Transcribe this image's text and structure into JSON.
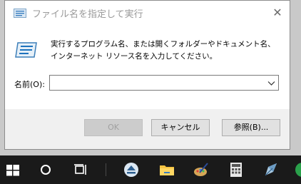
{
  "window": {
    "title": "ファイル名を指定して実行",
    "close_label": "✕"
  },
  "dialog": {
    "description": "実行するプログラム名、または開くフォルダーやドキュメント名、インターネット リソース名を入力してください。",
    "name_label": "名前(O):",
    "name_value": "",
    "ok_label": "OK",
    "cancel_label": "キャンセル",
    "browse_label": "参照(B)..."
  },
  "taskbar": {
    "icons": [
      "windows-start-icon",
      "search-circle-icon",
      "task-view-icon",
      "eject-icon",
      "folder-icon",
      "paint-icon",
      "calculator-icon",
      "pen-tool-icon",
      "chrome-icon"
    ]
  },
  "colors": {
    "titlebar": "#ffffff",
    "dialog_bg": "#f0f0f0",
    "taskbar": "#1a1a1a",
    "accent": "#1e73be"
  }
}
